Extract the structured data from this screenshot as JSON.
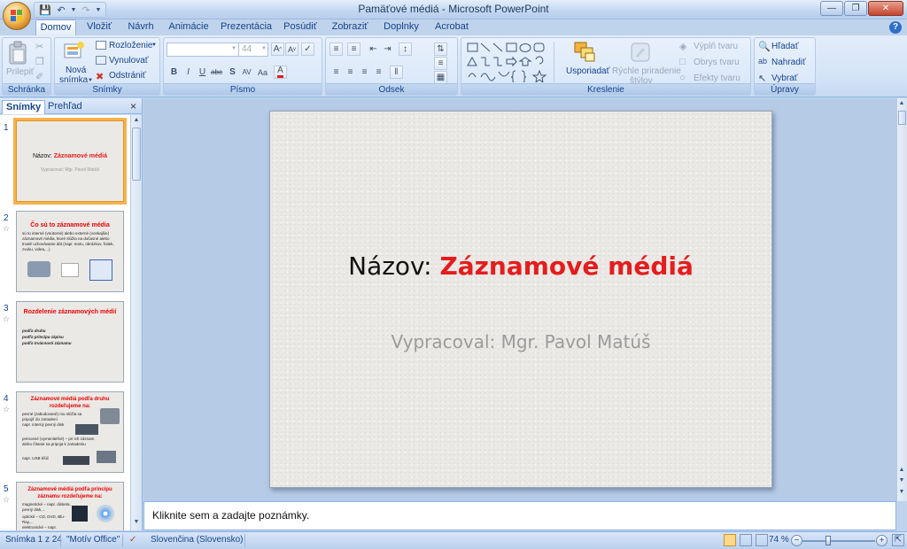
{
  "window": {
    "title": "Pamäťové médiá - Microsoft PowerPoint"
  },
  "tabs": [
    "Domov",
    "Vložiť",
    "Návrh",
    "Animácie",
    "Prezentácia",
    "Posúdiť",
    "Zobraziť",
    "Doplnky",
    "Acrobat"
  ],
  "active_tab": "Domov",
  "ribbon": {
    "clipboard": {
      "label": "Schránka",
      "paste": "Prilepiť"
    },
    "slides": {
      "label": "Snímky",
      "new_slide": "Nová",
      "new_slide2": "snímka",
      "layout": "Rozloženie",
      "reset": "Vynulovať",
      "delete": "Odstrániť"
    },
    "font": {
      "label": "Písmo",
      "size": "44"
    },
    "paragraph": {
      "label": "Odsek"
    },
    "drawing": {
      "label": "Kreslenie",
      "arrange": "Usporiadať",
      "quick_styles": "Rýchle priradenie",
      "quick_styles2": "štýlov",
      "fill": "Výplň tvaru",
      "outline": "Obrys tvaru",
      "effects": "Efekty tvaru"
    },
    "editing": {
      "label": "Úpravy",
      "find": "Hľadať",
      "replace": "Nahradiť",
      "select": "Vybrať"
    }
  },
  "left_panel": {
    "tab_slides": "Snímky",
    "tab_outline": "Prehľad",
    "thumbnails": [
      {
        "num": "1",
        "title_black": "Názov:",
        "title_red": "Záznamové médiá",
        "sub": "Vypracoval: Mgr. Pavol Matúš"
      },
      {
        "num": "2",
        "title": "Čo sú to záznamové média",
        "body": "sú to interné (vnútorné) alebo externé (vonkajšie) záznamové média, ktoré slúžia na dočasné alebo trvalé uchovávanie dát (napr. textu, obrázkov, fotiek, zvuku, videa,...)"
      },
      {
        "num": "3",
        "title": "Rozdelenie záznamových médií",
        "b1": "podľa druhu",
        "b2": "podľa princípu zápisu",
        "b3": "podľa trvácnosti záznamu"
      },
      {
        "num": "4",
        "title": "Záznamové médiá podľa druhu rozdeľujeme na:",
        "b1": "pevné (zabudované) mu slúžia sa pripojiť do zariadení",
        "b1b": "napr. interný pevný disk",
        "b2": "prenosné (vymeniteľné) – pri ich záznam alebo čítanie sa pripoja k zariadeniu",
        "b2b": "napr. USB kľúč"
      },
      {
        "num": "5",
        "title": "Záznamové médiá podľa princípu záznamu rozdeľujeme na:",
        "b1": "magnetické – napr. disketa, pevný disk,...",
        "b2": "optické – CD, DVD, Blu-Ray,...",
        "b3": "elektronické – napr."
      }
    ]
  },
  "slide": {
    "title_prefix": "Názov:",
    "title_main": "Záznamové médiá",
    "subtitle": "Vypracoval: Mgr. Pavol Matúš"
  },
  "notes": {
    "placeholder": "Kliknite sem a zadajte poznámky."
  },
  "status_bar": {
    "slide_info": "Snímka 1 z 24",
    "theme": "\"Motív Office\"",
    "language": "Slovenčina (Slovensko)",
    "zoom": "74 %"
  },
  "colors": {
    "accent_red": "#e41d1d",
    "ribbon_blue": "#bfd3ec",
    "selection_orange": "#f6b24c"
  }
}
